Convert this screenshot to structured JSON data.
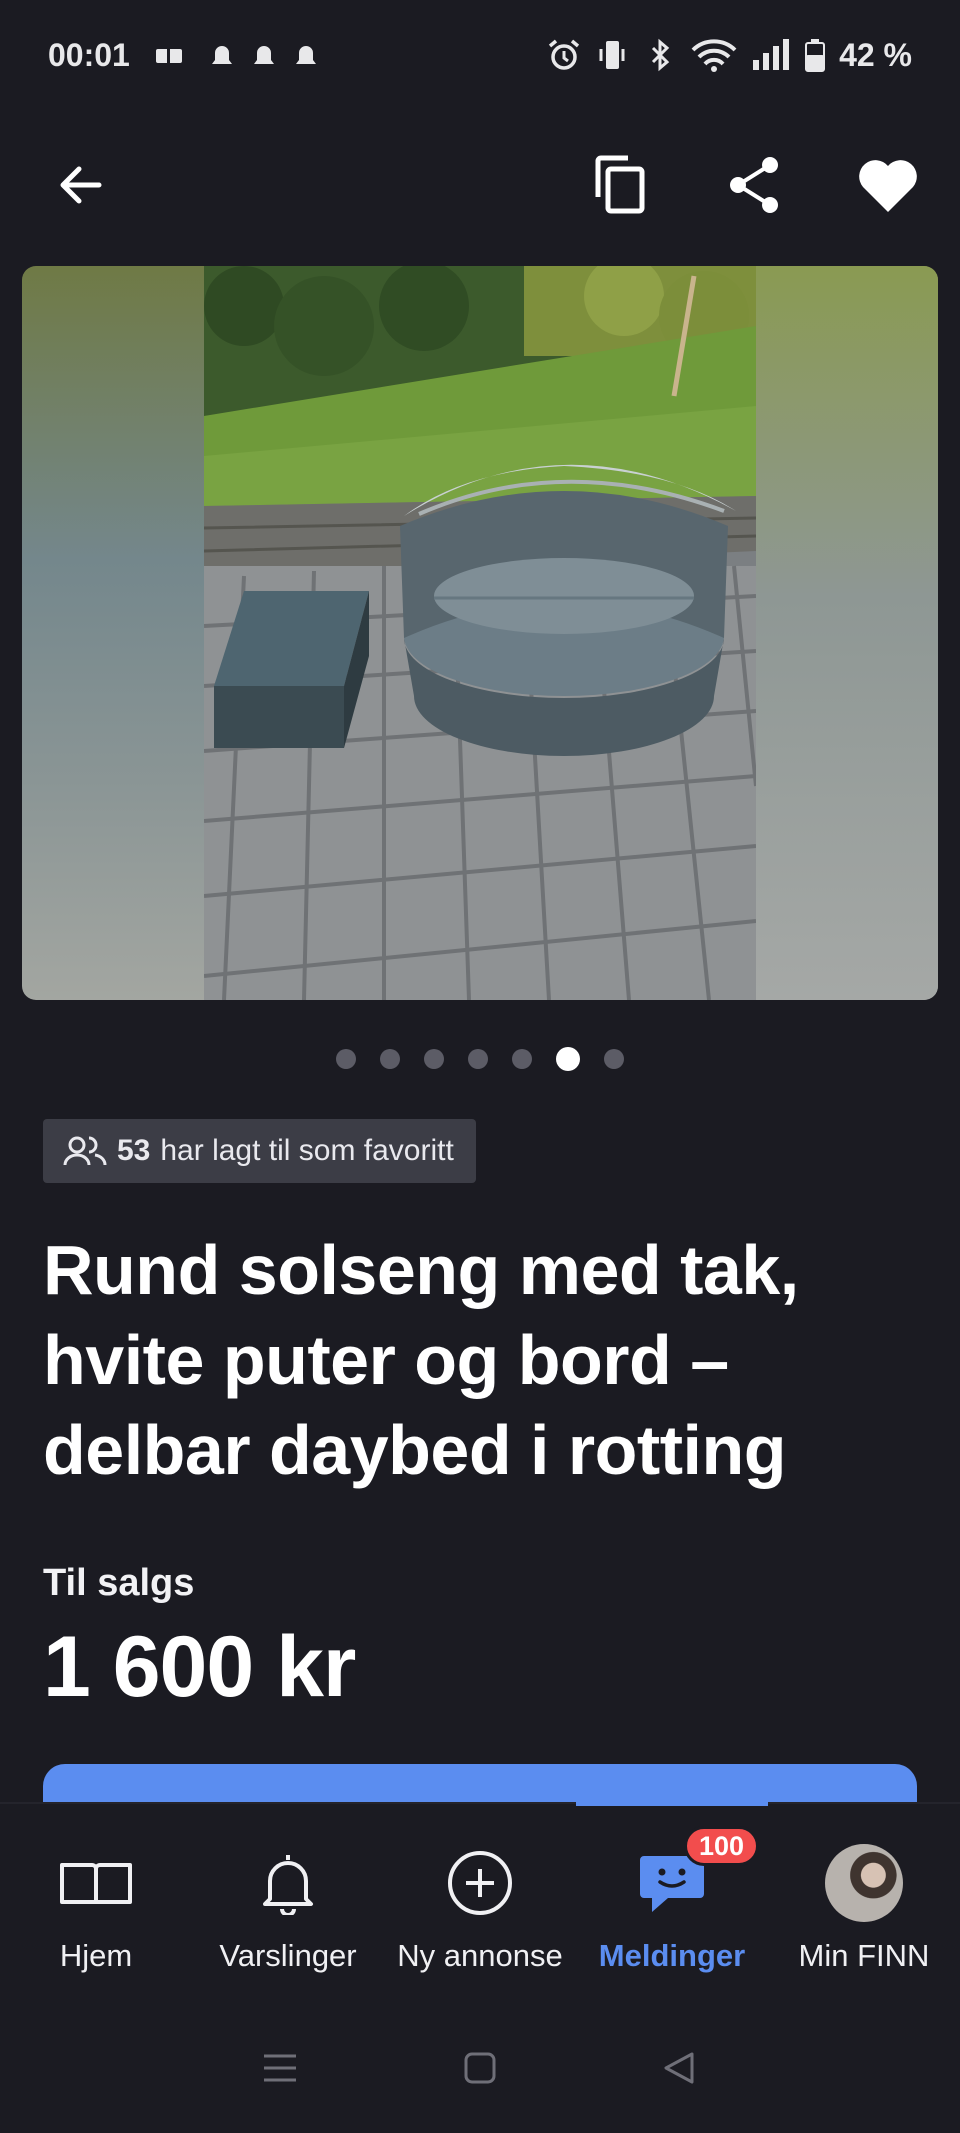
{
  "status_bar": {
    "time": "00:01",
    "battery": "42 %"
  },
  "top_bar": {
    "back_icon": "arrow-left-icon",
    "copy_icon": "copy-icon",
    "share_icon": "share-icon",
    "favorite_icon": "heart-icon"
  },
  "gallery": {
    "image_count": 7,
    "active_index": 5
  },
  "favorites": {
    "count": "53",
    "text": "har lagt til som favoritt"
  },
  "listing": {
    "title": "Rund solseng med tak, hvite puter og bord – delbar daybed i rotting",
    "sale_label": "Til salgs",
    "price": "1 600 kr"
  },
  "bottom_nav": {
    "items": [
      {
        "label": "Hjem",
        "icon": "book-icon"
      },
      {
        "label": "Varslinger",
        "icon": "bell-icon"
      },
      {
        "label": "Ny annonse",
        "icon": "plus-circle-icon"
      },
      {
        "label": "Meldinger",
        "icon": "chat-icon",
        "badge": "100",
        "active": true
      },
      {
        "label": "Min FINN",
        "icon": "avatar-icon"
      }
    ]
  },
  "colors": {
    "background": "#1b1b22",
    "accent": "#5b8df0",
    "badge": "#f24d4d"
  }
}
